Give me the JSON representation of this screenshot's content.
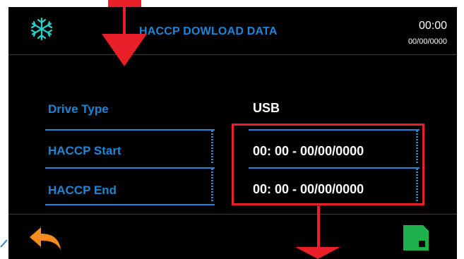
{
  "header": {
    "title": "HACCP DOWLOAD DATA",
    "time": "00:00",
    "date": "00/00/0000",
    "icon": "snowflake-icon"
  },
  "rows": [
    {
      "label": "Drive Type",
      "value": "USB"
    },
    {
      "label": "HACCP Start",
      "value": "00: 00 - 00/00/0000"
    },
    {
      "label": "HACCP End",
      "value": "00: 00 - 00/00/0000"
    }
  ],
  "footer": {
    "back_icon": "back-arrow-icon",
    "save_icon": "floppy-save-icon"
  },
  "colors": {
    "accent_blue": "#1e86d6",
    "highlight_red": "#e8202a",
    "back_orange": "#f28c1e",
    "save_green": "#1eb04a",
    "background": "#000000"
  }
}
